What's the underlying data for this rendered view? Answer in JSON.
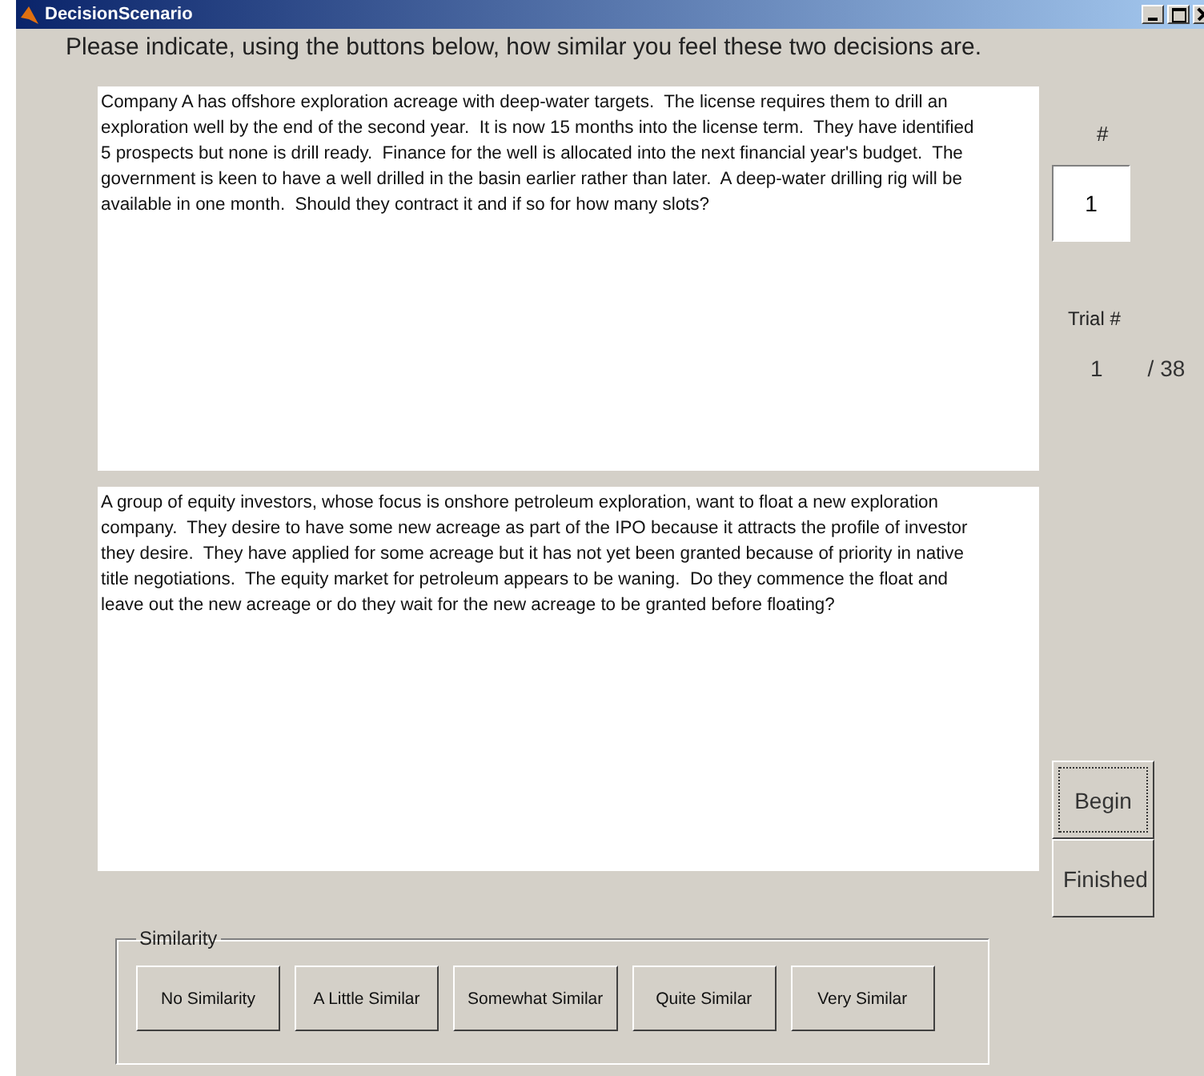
{
  "window": {
    "title": "DecisionScenario"
  },
  "instruction": "Please indicate, using the buttons below, how similar you feel these two decisions are.",
  "scenarios": [
    {
      "text": "Company A has offshore exploration acreage with deep-water targets.  The license requires them to drill an exploration well by the end of the second year.  It is now 15 months into the license term.  They have identified 5 prospects but none is drill ready.  Finance for the well is allocated into the next financial year's budget.  The government is keen to have a well drilled in the basin earlier rather than later.  A deep-water drilling rig will be available in one month.  Should they contract it and if so for how many slots?"
    },
    {
      "text": "A group of equity investors, whose focus is onshore petroleum exploration, want to float a new exploration company.  They desire to have some new acreage as part of the IPO because it attracts the profile of investor they desire.  They have applied for some acreage but it has not yet been granted because of priority in native title negotiations.  The equity market for petroleum appears to be waning.  Do they commence the float and leave out the new acreage or do they wait for the new acreage to be granted before floating?"
    }
  ],
  "number": {
    "label": "#",
    "value": "1"
  },
  "trial": {
    "label": "Trial #",
    "current": "1",
    "total": "/ 38"
  },
  "side_buttons": [
    {
      "label": "Begin",
      "focused": true
    },
    {
      "label": "Finished",
      "focused": false
    }
  ],
  "similarity": {
    "title": "Similarity",
    "buttons": [
      "No Similarity",
      "A Little Similar",
      "Somewhat Similar",
      "Quite Similar",
      "Very Similar"
    ]
  }
}
